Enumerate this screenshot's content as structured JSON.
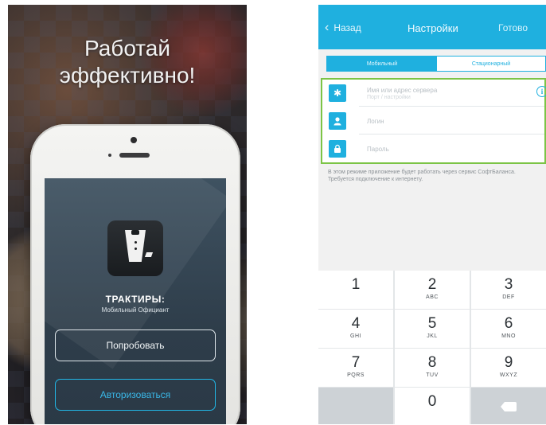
{
  "promo": {
    "headline": "Работай\nэффективно!",
    "app_name": "ТРАКТИРЫ:",
    "app_subtitle": "Мобильный Официант",
    "try_button": "Попробовать",
    "auth_button": "Авторизоваться"
  },
  "settings": {
    "back_label": "Назад",
    "title": "Настройки",
    "done_label": "Готово",
    "segments": [
      "Мобильный",
      "Стационарный"
    ],
    "fields": [
      {
        "icon": "server-icon",
        "line1": "Имя или адрес сервера",
        "line2": "Порт / настройки"
      },
      {
        "icon": "user-icon",
        "line1": "Логин",
        "line2": ""
      },
      {
        "icon": "lock-icon",
        "line1": "Пароль",
        "line2": ""
      }
    ],
    "note": "В этом режиме приложение будет работать через сервис СофтБаланса. Требуется подключение к интернету."
  },
  "keypad": {
    "keys": [
      {
        "num": "1",
        "letters": ""
      },
      {
        "num": "2",
        "letters": "ABC"
      },
      {
        "num": "3",
        "letters": "DEF"
      },
      {
        "num": "4",
        "letters": "GHI"
      },
      {
        "num": "5",
        "letters": "JKL"
      },
      {
        "num": "6",
        "letters": "MNO"
      },
      {
        "num": "7",
        "letters": "PQRS"
      },
      {
        "num": "8",
        "letters": "TUV"
      },
      {
        "num": "9",
        "letters": "WXYZ"
      },
      {
        "num": "",
        "letters": ""
      },
      {
        "num": "0",
        "letters": ""
      },
      {
        "num": "",
        "letters": ""
      }
    ]
  },
  "colors": {
    "accent": "#1fb0df",
    "highlight": "#7cc446"
  }
}
